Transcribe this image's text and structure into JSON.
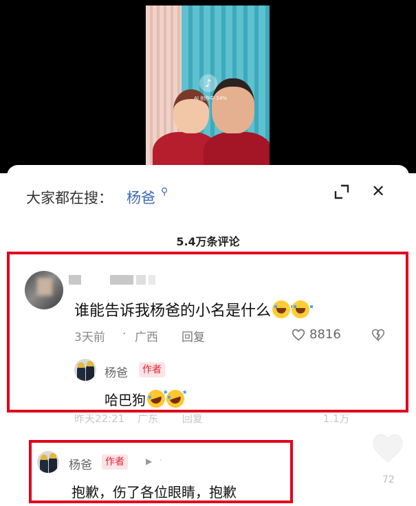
{
  "video": {
    "badge_text": "AI 创作中 14%"
  },
  "search_bar": {
    "prefix": "大家都在搜：",
    "keyword": "杨爸"
  },
  "comments_header": {
    "count_label": "5.4万条评论"
  },
  "comment": {
    "text": "谁能告诉我杨爸的小名是什么",
    "time": "3天前",
    "separator": "·",
    "location": "广西",
    "reply_label": "回复",
    "like_count": "8816",
    "reply": {
      "username": "杨爸",
      "badge": "作者",
      "text": "哈巴狗"
    }
  },
  "partial_row": {
    "time": "昨天22:21",
    "location": "广东",
    "reply_label": "回复",
    "like_count": "1.1万"
  },
  "author_comment": {
    "username": "杨爸",
    "badge": "作者",
    "text": "抱歉，伤了各位眼睛，抱歉",
    "like_count": "72"
  },
  "colors": {
    "highlight_red": "#e1001d",
    "link_blue": "#3d6bb5",
    "author_badge_bg": "#fde3e5",
    "author_badge_text": "#e02535"
  }
}
